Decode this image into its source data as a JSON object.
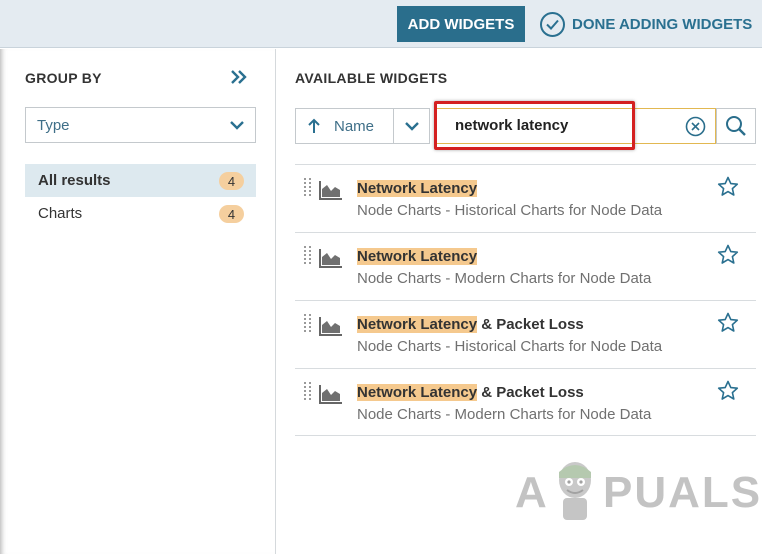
{
  "toolbar": {
    "add_widgets": "ADD WIDGETS",
    "done_adding": "DONE ADDING WIDGETS"
  },
  "group_by": {
    "title": "GROUP BY",
    "select_value": "Type",
    "filters": [
      {
        "label": "All results",
        "count": "4",
        "active": true
      },
      {
        "label": "Charts",
        "count": "4",
        "active": false
      }
    ]
  },
  "available": {
    "title": "AVAILABLE WIDGETS",
    "sort_label": "Name",
    "search_value": "network latency",
    "results": [
      {
        "title_highlight": "Network Latency",
        "title_rest": "",
        "subtitle": "Node Charts - Historical Charts for Node Data"
      },
      {
        "title_highlight": "Network Latency",
        "title_rest": "",
        "subtitle": "Node Charts - Modern Charts for Node Data"
      },
      {
        "title_highlight": "Network Latency",
        "title_rest": " & Packet Loss",
        "subtitle": "Node Charts - Historical Charts for Node Data"
      },
      {
        "title_highlight": "Network Latency",
        "title_rest": " & Packet Loss",
        "subtitle": "Node Charts - Modern Charts for Node Data"
      }
    ]
  },
  "watermark": {
    "left": "A",
    "right": "PUALS"
  },
  "colors": {
    "accent": "#2a6e8c",
    "highlight": "#f5c98e",
    "badge": "#f5cf9e",
    "callout": "#d42020"
  },
  "icons": [
    "check-circle-icon",
    "double-chevron-right-icon",
    "chevron-down-icon",
    "arrow-up-icon",
    "clear-icon",
    "search-icon",
    "drag-handle-icon",
    "area-chart-icon",
    "star-icon"
  ]
}
